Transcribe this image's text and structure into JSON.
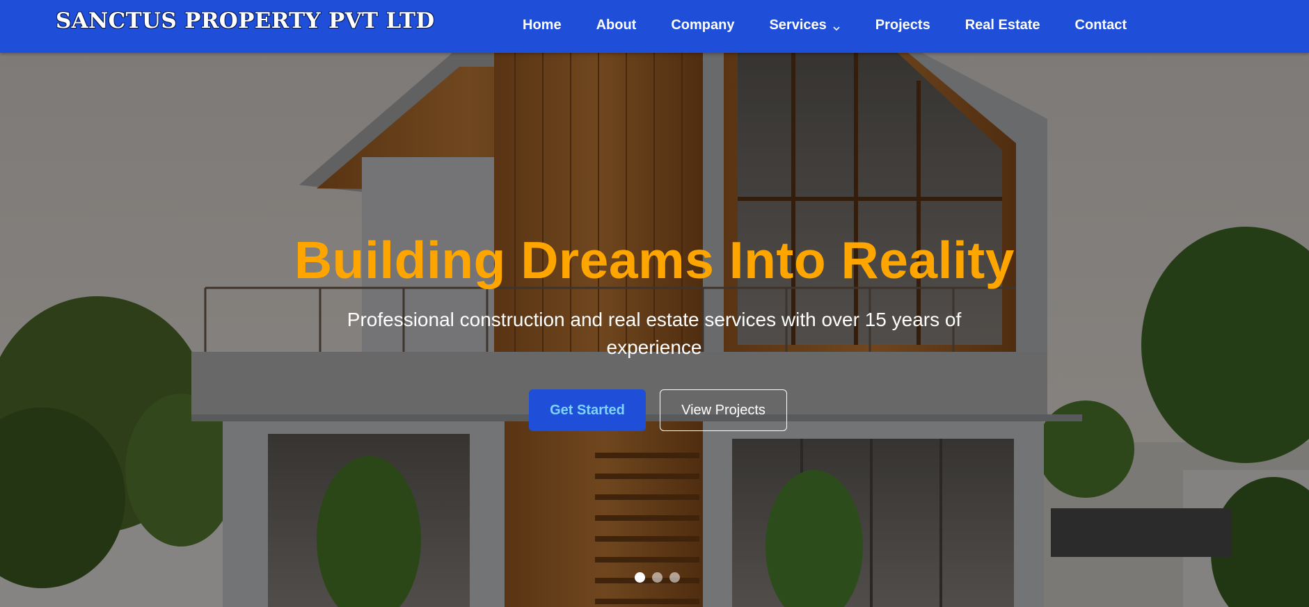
{
  "brand": {
    "logo_text": "SANCTUS PROPERTY PVT LTD"
  },
  "nav": {
    "items": [
      {
        "label": "Home"
      },
      {
        "label": "About"
      },
      {
        "label": "Company"
      },
      {
        "label": "Services",
        "has_dropdown": true,
        "icon": "chevron-down-icon"
      },
      {
        "label": "Projects"
      },
      {
        "label": "Real Estate"
      },
      {
        "label": "Contact"
      }
    ]
  },
  "hero": {
    "title": "Building Dreams Into Reality",
    "subtitle": "Professional construction and real estate services with over 15 years of experience",
    "primary_button": "Get Started",
    "secondary_button": "View Projects",
    "slides_total": 3,
    "active_slide": 1
  },
  "colors": {
    "nav_bg": "#1f4fd8",
    "title": "#ffa500",
    "primary_button_bg": "#1f4fd8",
    "primary_button_text": "#7fd4ff"
  }
}
